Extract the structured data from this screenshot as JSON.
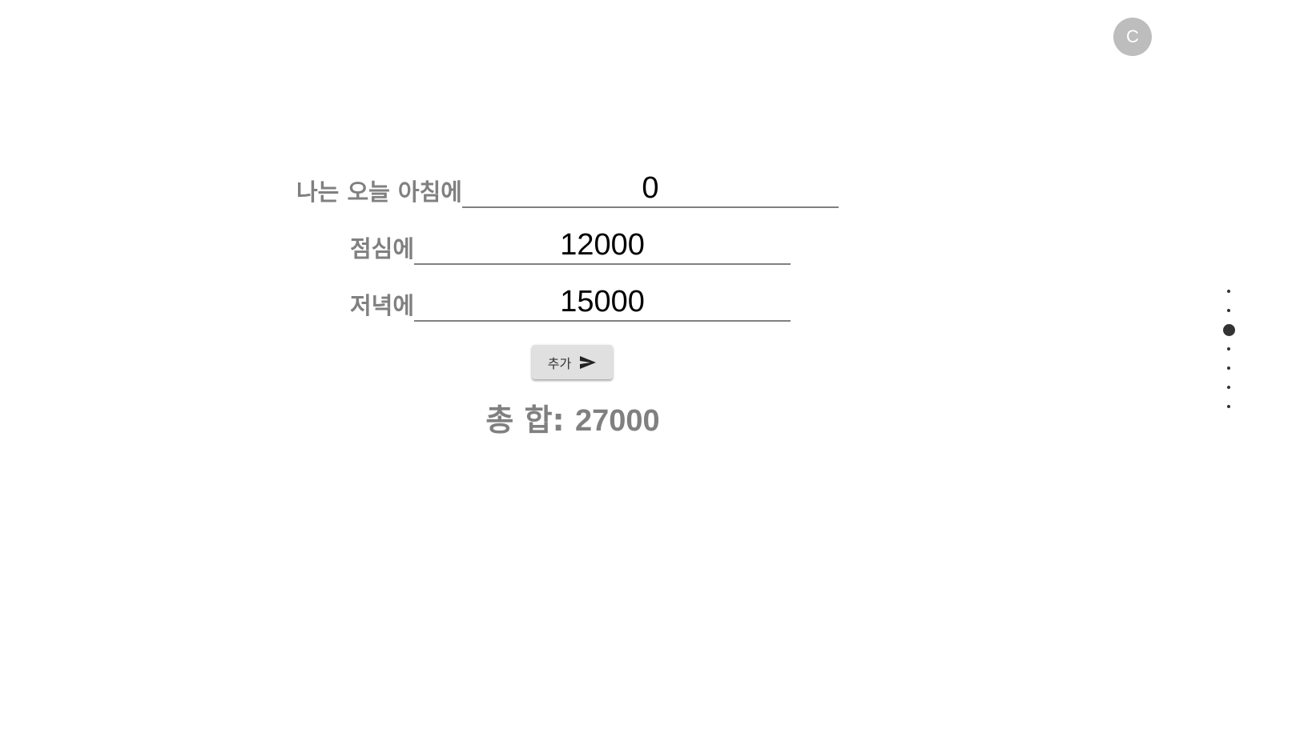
{
  "header": {
    "avatar_letter": "C"
  },
  "form": {
    "rows": [
      {
        "label": "나는 오늘 아침에",
        "value": "0"
      },
      {
        "label": "점심에",
        "value": "12000"
      },
      {
        "label": "저녁에",
        "value": "15000"
      }
    ],
    "add_button_label": "추가",
    "add_button_icon": "send-icon"
  },
  "total": {
    "label": "총 합: ",
    "value": "27000"
  },
  "pager": {
    "count": 7,
    "active_index": 2
  },
  "colors": {
    "label_gray": "#808080",
    "avatar_bg": "#bdbdbd",
    "button_bg": "#e0e0e0",
    "dot": "#333333"
  }
}
